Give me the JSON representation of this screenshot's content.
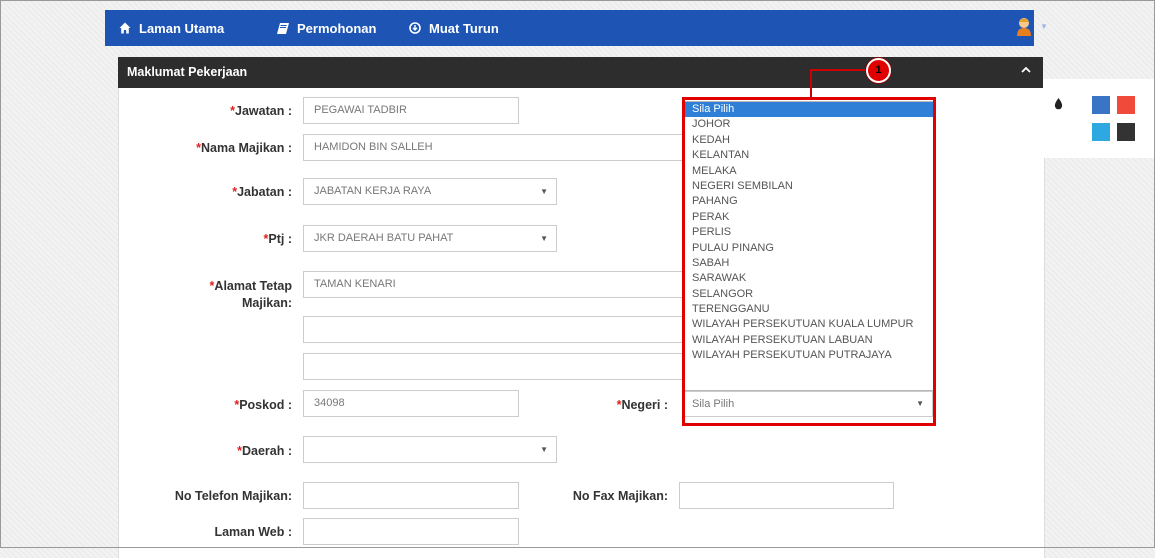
{
  "nav": {
    "home": "Laman Utama",
    "apply": "Permohonan",
    "download": "Muat Turun"
  },
  "panel": {
    "title": "Maklumat Pekerjaan"
  },
  "form": {
    "jawatan": {
      "label": "Jawatan :",
      "value": "PEGAWAI TADBIR"
    },
    "nama_majikan": {
      "label": "Nama Majikan :",
      "value": "HAMIDON BIN SALLEH"
    },
    "jabatan": {
      "label": "Jabatan :",
      "value": "JABATAN KERJA RAYA"
    },
    "ptj": {
      "label": "Ptj :",
      "value": "JKR DAERAH BATU PAHAT"
    },
    "alamat": {
      "label_1": "Alamat Tetap",
      "label_2": "Majikan:",
      "line1": "TAMAN KENARI",
      "line2": "",
      "line3": ""
    },
    "poskod": {
      "label": "Poskod :",
      "value": "34098"
    },
    "negeri": {
      "label": "Negeri :",
      "value": "Sila Pilih"
    },
    "daerah": {
      "label": "Daerah :",
      "value": ""
    },
    "no_telefon": {
      "label": "No Telefon Majikan:",
      "value": ""
    },
    "no_fax": {
      "label": "No Fax Majikan:",
      "value": ""
    },
    "laman_web": {
      "label": "Laman Web :",
      "value": ""
    }
  },
  "negeri_options": [
    "Sila Pilih",
    "JOHOR",
    "KEDAH",
    "KELANTAN",
    "MELAKA",
    "NEGERI SEMBILAN",
    "PAHANG",
    "PERAK",
    "PERLIS",
    "PULAU PINANG",
    "SABAH",
    "SARAWAK",
    "SELANGOR",
    "TERENGGANU",
    "WILAYAH PERSEKUTUAN KUALA LUMPUR",
    "WILAYAH PERSEKUTUAN LABUAN",
    "WILAYAH PERSEKUTUAN PUTRAJAYA"
  ],
  "callout": "1",
  "required_mark": "*",
  "icons": {
    "home": "home-icon",
    "apply": "book-icon",
    "download": "download-icon",
    "user": "user-avatar-icon",
    "collapse": "chevron-up-icon",
    "theme": "droplet-icon"
  },
  "colors": {
    "navbar": "#1e55b5",
    "panel_header": "#2d2d2d",
    "highlight": "#2f7fd6",
    "annotation": "#e00000",
    "swatches": [
      "#3a74c4",
      "#f04b3a",
      "#2ea8e0",
      "#333333"
    ]
  }
}
